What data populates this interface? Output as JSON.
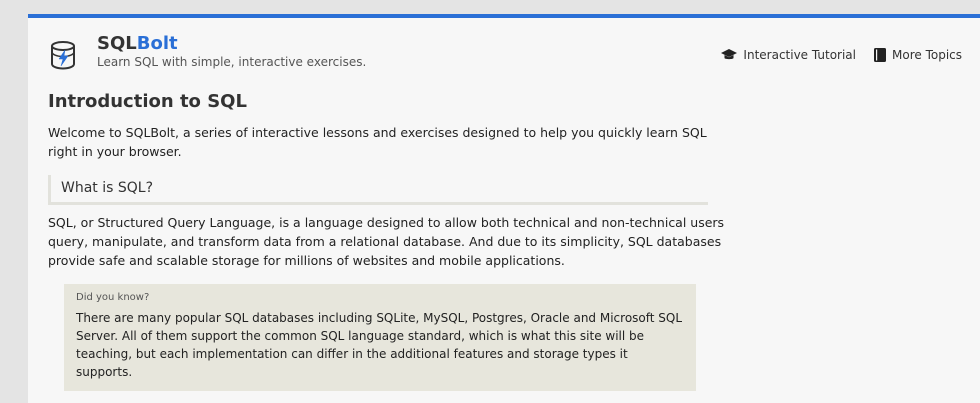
{
  "header": {
    "brand_prefix": "SQL",
    "brand_suffix": "Bolt",
    "tagline": "Learn SQL with simple, interactive exercises.",
    "icon": "database-bolt-icon"
  },
  "nav": {
    "tutorial_label": "Interactive Tutorial",
    "tutorial_icon": "graduation-cap-icon",
    "topics_label": "More Topics",
    "topics_icon": "book-icon"
  },
  "main": {
    "title": "Introduction to SQL",
    "intro": "Welcome to SQLBolt, a series of interactive lessons and exercises designed to help you quickly learn SQL right in your browser.",
    "section_title": "What is SQL?",
    "section_body": "SQL, or Structured Query Language, is a language designed to allow both technical and non-technical users query, manipulate, and transform data from a relational database. And due to its simplicity, SQL databases provide safe and scalable storage for millions of websites and mobile applications.",
    "callout_title": "Did you know?",
    "callout_body": "There are many popular SQL databases including SQLite, MySQL, Postgres, Oracle and Microsoft SQL Server. All of them support the common SQL language standard, which is what this site will be teaching, but each implementation can differ in the additional features and storage types it supports."
  },
  "colors": {
    "accent": "#2a6fd6",
    "callout_bg": "#e7e6dc"
  }
}
